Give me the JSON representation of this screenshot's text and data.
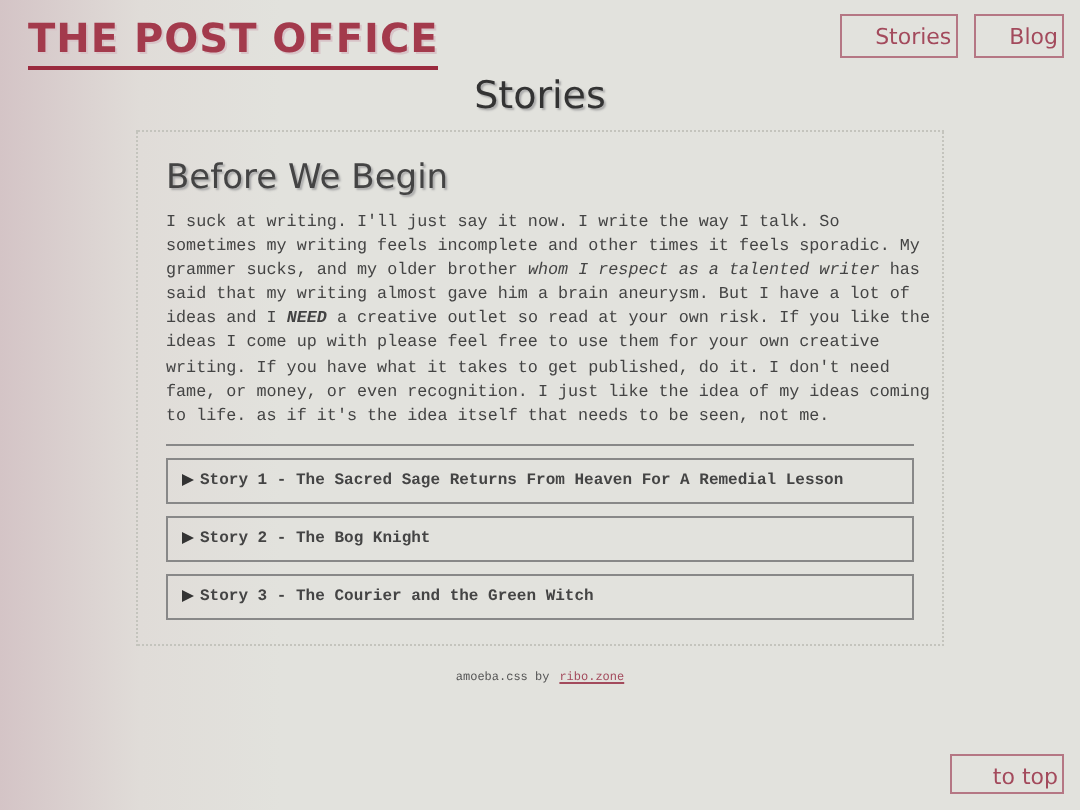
{
  "site_title": "THE POST OFFICE",
  "nav": [
    {
      "label": "Stories",
      "selected": false
    },
    {
      "label": "Blog",
      "selected": false
    }
  ],
  "page_heading": "Stories",
  "intro": {
    "heading": "Before We Begin",
    "text": "I suck at writing. I'll just say it now. I write the way I talk. So sometimes my writing feels incomplete and other times it feels sporadic. My grammer sucks, and my older brother *whom I respect as a talented writer* has said that my writing almost gave him a brain aneurysm. But I have a lot of ideas and I **NEED** a creative outlet so read at your own risk. If you like the ideas I come up with please feel free to use them for your own creative writing. If you have what it takes to get published, do it. I don't need fame, or money, or even recognition. I just like the idea of my ideas coming to life. as if it's the idea itself that needs to be seen, not me."
  },
  "stories": [
    {
      "title": "Story 1 - The Sacred Sage Returns From Heaven For A Remedial Lesson",
      "expanded": false
    },
    {
      "title": "Story 2 - The Bog Knight",
      "expanded": false
    },
    {
      "title": "Story 3 - The Courier and the Green Witch",
      "expanded": false
    }
  ],
  "footer": {
    "text": "amoeba.css by",
    "link": "ribo.zone"
  },
  "to_top": "to top"
}
